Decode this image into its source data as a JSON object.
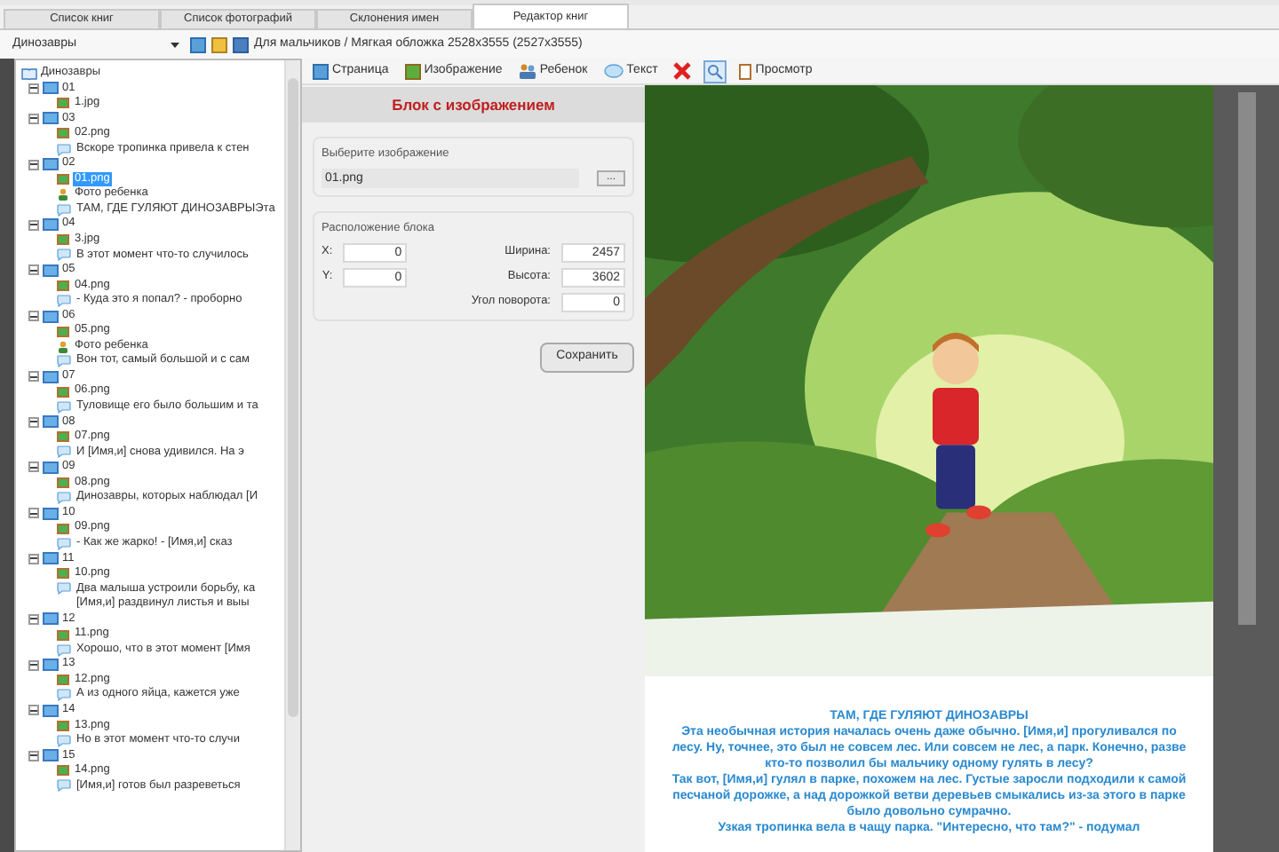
{
  "tabs": [
    {
      "label": "Список книг",
      "selected": false
    },
    {
      "label": "Список фотографий",
      "selected": false
    },
    {
      "label": "Склонения имен",
      "selected": false
    },
    {
      "label": "Редактор книг",
      "selected": true
    }
  ],
  "book_selector": {
    "value": "Динозавры"
  },
  "breadcrumb": "Для мальчиков / Мягкая обложка 2528x3555 (2527x3555)",
  "tree": {
    "label": "Динозавры",
    "children": [
      {
        "label": "01",
        "expanded": true,
        "children": [
          {
            "label": "1.jpg",
            "selected": false
          }
        ]
      },
      {
        "label": "03",
        "expanded": true,
        "children": [
          {
            "label": "02.png",
            "selected": false
          },
          {
            "kind": "text",
            "label": "Вскоре тропинка привела к стен",
            "selected": false
          }
        ]
      },
      {
        "label": "02",
        "expanded": true,
        "children": [
          {
            "label": "01.png",
            "selected": true
          },
          {
            "kind": "child",
            "label": "Фото ребенка",
            "selected": false
          },
          {
            "kind": "text",
            "label": "ТАМ, ГДЕ ГУЛЯЮТ ДИНОЗАВРЫЭта",
            "selected": false
          }
        ]
      },
      {
        "label": "04",
        "expanded": true,
        "children": [
          {
            "label": "3.jpg",
            "selected": false
          },
          {
            "kind": "text",
            "label": "В этот момент что-то случилось",
            "selected": false
          }
        ]
      },
      {
        "label": "05",
        "expanded": true,
        "children": [
          {
            "label": "04.png",
            "selected": false
          },
          {
            "kind": "text",
            "label": "- Куда это я попал? - проборно",
            "selected": false
          }
        ]
      },
      {
        "label": "06",
        "expanded": true,
        "children": [
          {
            "label": "05.png",
            "selected": false
          },
          {
            "kind": "child",
            "label": "Фото ребенка",
            "selected": false
          },
          {
            "kind": "text",
            "label": "Вон тот, самый большой и с сам",
            "selected": false
          }
        ]
      },
      {
        "label": "07",
        "expanded": true,
        "children": [
          {
            "label": "06.png",
            "selected": false
          },
          {
            "kind": "text",
            "label": "Туловище его было большим и та",
            "selected": false
          }
        ]
      },
      {
        "label": "08",
        "expanded": true,
        "children": [
          {
            "label": "07.png",
            "selected": false
          },
          {
            "kind": "text",
            "label": "И [Имя,и] снова удивился. На э",
            "selected": false
          }
        ]
      },
      {
        "label": "09",
        "expanded": true,
        "children": [
          {
            "label": "08.png",
            "selected": false
          },
          {
            "kind": "text",
            "label": "Динозавры, которых наблюдал [И",
            "selected": false
          }
        ]
      },
      {
        "label": "10",
        "expanded": true,
        "children": [
          {
            "label": "09.png",
            "selected": false
          },
          {
            "kind": "text",
            "label": "- Как же жарко! - [Имя,и] сказ",
            "selected": false
          }
        ]
      },
      {
        "label": "11",
        "expanded": true,
        "children": [
          {
            "label": "10.png",
            "selected": false
          },
          {
            "kind": "text",
            "label": "Два малыша устроили борьбу, ка\n[Имя,и] раздвинул листья и выы",
            "selected": false
          }
        ]
      },
      {
        "label": "12",
        "expanded": true,
        "children": [
          {
            "label": "11.png",
            "selected": false
          },
          {
            "kind": "text",
            "label": "Хорошо, что в этот момент [Имя",
            "selected": false
          }
        ]
      },
      {
        "label": "13",
        "expanded": true,
        "children": [
          {
            "label": "12.png",
            "selected": false
          },
          {
            "kind": "text",
            "label": "А из одного яйца, кажется уже",
            "selected": false
          }
        ]
      },
      {
        "label": "14",
        "expanded": true,
        "children": [
          {
            "label": "13.png",
            "selected": false
          },
          {
            "kind": "text",
            "label": "Но в этот момент что-то случи",
            "selected": false
          }
        ]
      },
      {
        "label": "15",
        "expanded": true,
        "children": [
          {
            "label": "14.png",
            "selected": false
          },
          {
            "kind": "text",
            "label": "[Имя,и] готов был разреветься",
            "selected": false
          }
        ]
      }
    ]
  },
  "toolbar": [
    {
      "kind": "page",
      "label": "Страница",
      "pressed": false
    },
    {
      "label": "Изображение",
      "pressed": false
    },
    {
      "kind": "child",
      "label": "Ребенок",
      "pressed": false
    },
    {
      "kind": "text",
      "label": "Текст",
      "pressed": false
    },
    {
      "kind": "delete",
      "pressed": false
    },
    {
      "kind": "zoom",
      "pressed": true
    },
    {
      "kind": "preview",
      "label": "Просмотр",
      "pressed": false
    }
  ],
  "block_panel": {
    "title": "Блок с изображением",
    "image_group": {
      "title": "Выберите изображение",
      "value": "01.png",
      "browse_label": "..."
    },
    "position_group": {
      "title": "Расположение блока",
      "left_fields": [
        {
          "label": "X:",
          "value": "0"
        },
        {
          "label": "Y:",
          "value": "0"
        }
      ],
      "right_fields": [
        {
          "label": "Ширина:",
          "value": "2457"
        },
        {
          "label": "Высота:",
          "value": "3602"
        },
        {
          "label": "Угол поворота:",
          "value": "0"
        }
      ]
    },
    "save_label": "Сохранить"
  },
  "preview": {
    "title": "ТАМ, ГДЕ ГУЛЯЮТ ДИНОЗАВРЫ",
    "paragraphs": [
      "Эта необычная история началась очень даже обычно. [Имя,и] прогуливался по лесу. Ну, точнее, это был не совсем лес. Или совсем не лес, а парк. Конечно, разве кто-то позволил бы мальчику одному гулять в лесу?",
      "Так вот, [Имя,и] гулял в парке, похожем на лес. Густые заросли подходили к самой песчаной дорожке, а над дорожкой ветви деревьев смыкались из-за этого в парке было довольно сумрачно.",
      "Узкая тропинка вела в чащу парка. \"Интересно, что там?\" - подумал"
    ]
  }
}
